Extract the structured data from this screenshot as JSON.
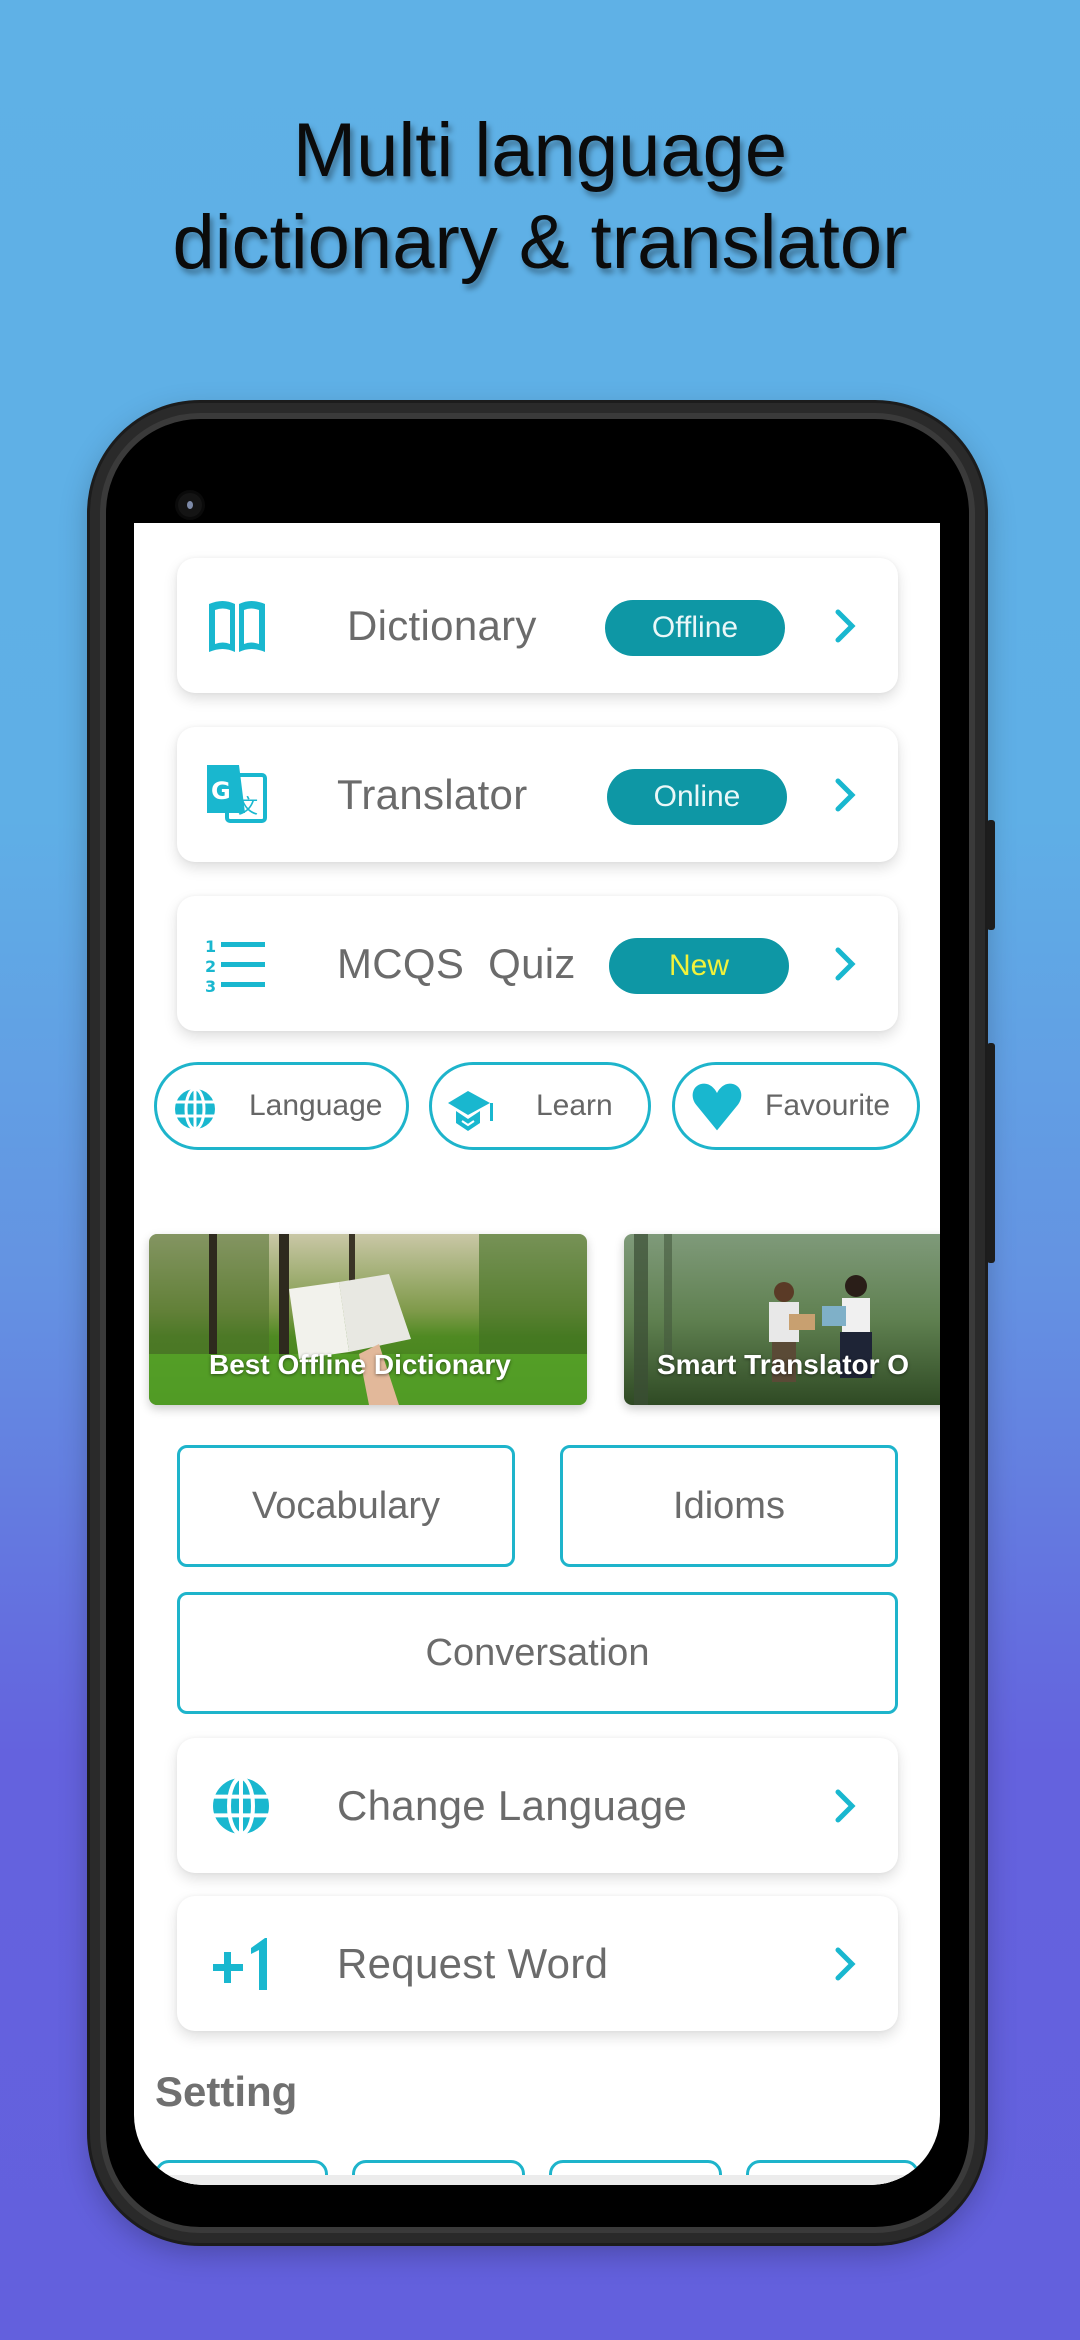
{
  "promo": {
    "headline_line1": "Multi language",
    "headline_line2": "dictionary & translator"
  },
  "colors": {
    "accent_cyan": "#19B7CF",
    "badge_teal": "#0E97A5",
    "badge_new_text": "#F2F23A",
    "text_gray": "#6B6B6B",
    "bg_top": "#5FB1E6",
    "bg_bottom": "#6360DD"
  },
  "main_cards": [
    {
      "icon": "book-open-icon",
      "label": "Dictionary",
      "badge": "Offline"
    },
    {
      "icon": "google-translate-icon",
      "label": "Translator",
      "badge": "Online"
    },
    {
      "icon": "numbered-list-icon",
      "label": "MCQS  Quiz",
      "badge": "New"
    }
  ],
  "pills": [
    {
      "icon": "globe-icon",
      "label": "Language"
    },
    {
      "icon": "graduation-cap-icon",
      "label": "Learn"
    },
    {
      "icon": "heart-icon",
      "label": "Favourite"
    }
  ],
  "banners": [
    {
      "caption": "Best Offline Dictionary"
    },
    {
      "caption": "Smart Translator O"
    }
  ],
  "categories": {
    "vocabulary": "Vocabulary",
    "idioms": "Idioms",
    "conversation": "Conversation"
  },
  "option_cards": [
    {
      "icon": "globe-icon",
      "label": "Change Language"
    },
    {
      "icon": "plus-one-icon",
      "label": "Request Word"
    }
  ],
  "settings": {
    "title": "Setting",
    "tiles": [
      {
        "icon": "tile-icon-1"
      },
      {
        "icon": "tile-icon-2"
      },
      {
        "icon": "tile-icon-3"
      },
      {
        "icon": "tile-icon-4"
      }
    ]
  }
}
